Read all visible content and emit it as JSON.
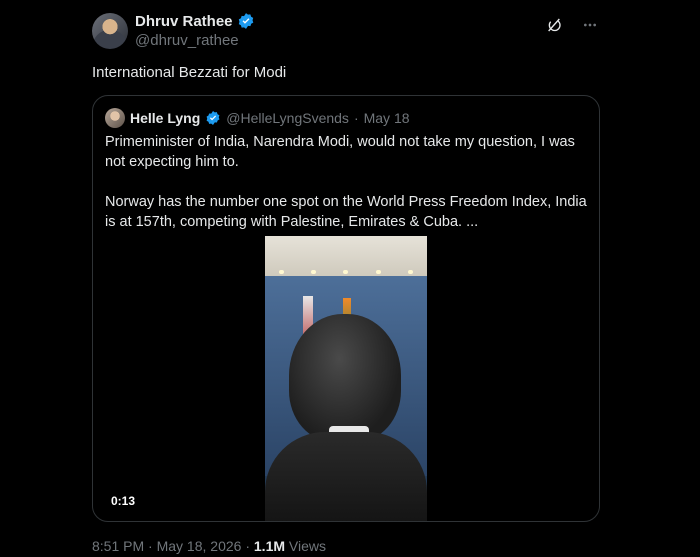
{
  "author": {
    "name": "Dhruv Rathee",
    "handle": "@dhruv_rathee",
    "avatar_icon": "profile-photo"
  },
  "tweet_text": "International Bezzati for Modi",
  "quoted": {
    "name": "Helle Lyng",
    "handle": "@HelleLyngSvends",
    "separator": "·",
    "date": "May 18",
    "paragraph1": "Primeminister of India, Narendra Modi, would not take my question, I was not expecting him to.",
    "paragraph2": "Norway has the number one spot on the World Press Freedom Index, India is at 157th, competing with Palestine, Emirates & Cuba. ...",
    "video_duration": "0:13"
  },
  "footer": {
    "time": "8:51 PM",
    "sep1": "·",
    "date": "May 18, 2026",
    "sep2": "·",
    "views_count": "1.1M",
    "views_label": "Views"
  },
  "colors": {
    "background": "#000000",
    "text": "#e7e9ea",
    "muted": "#71767b",
    "verified": "#1d9bf0",
    "border": "#2f3336"
  }
}
